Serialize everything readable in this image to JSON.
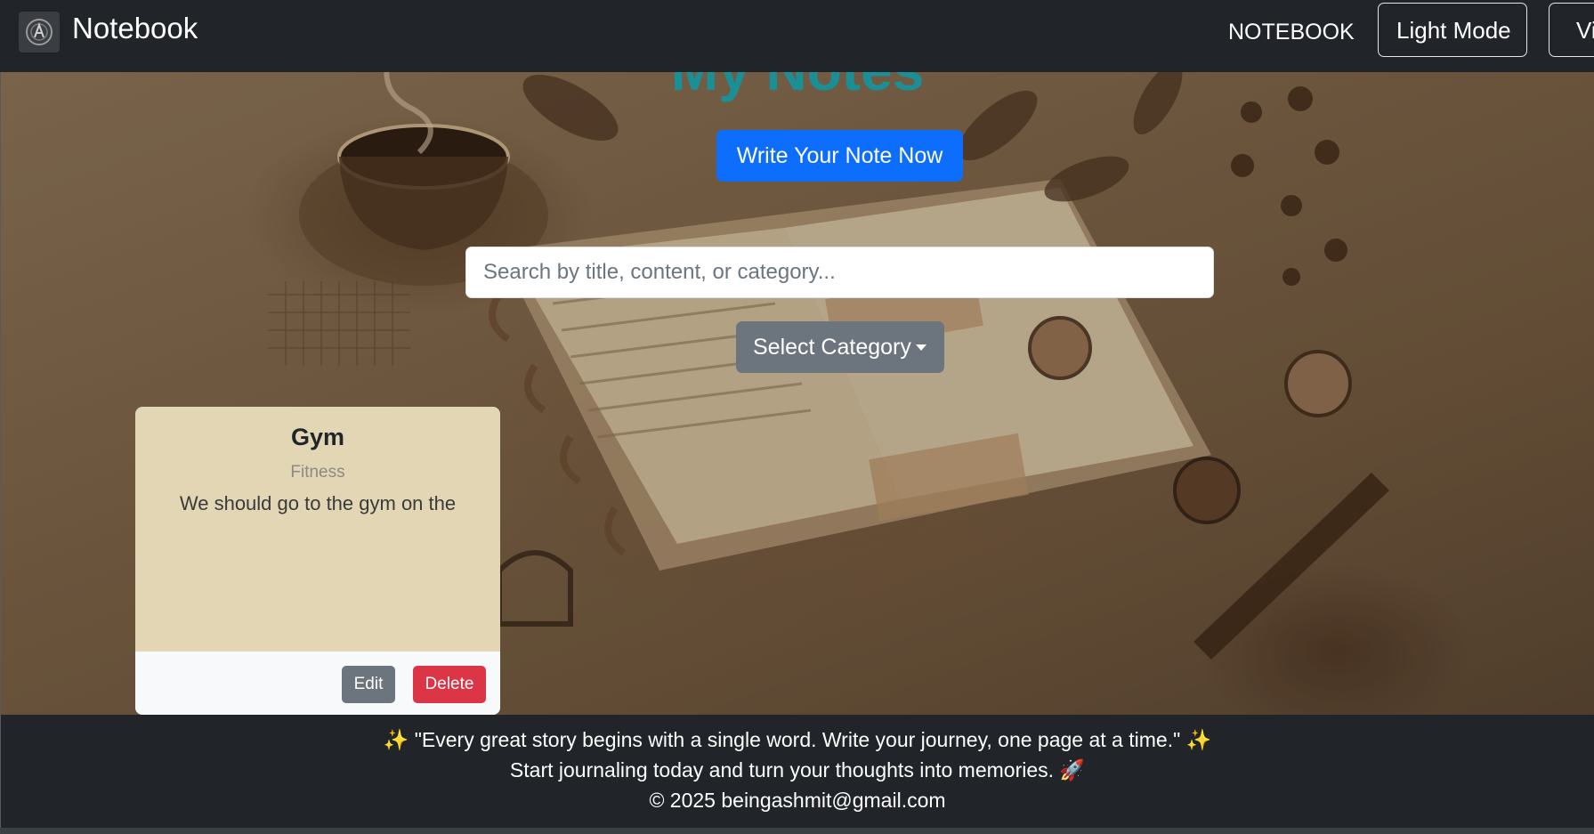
{
  "navbar": {
    "brand": "Notebook",
    "links": [
      "NOTEBOOK"
    ],
    "theme_button": "Light Mode",
    "extra_button": "Vi"
  },
  "hero": {
    "title": "My Notes",
    "write_button": "Write Your Note Now",
    "search_placeholder": "Search by title, content, or category...",
    "category_button": "Select Category"
  },
  "notes": [
    {
      "title": "Gym",
      "category": "Fitness",
      "content": "We should go to the gym on the",
      "edit_label": "Edit",
      "delete_label": "Delete"
    }
  ],
  "footer": {
    "quote": "✨  \"Every great story begins with a single word. Write your journey, one page at a time.\"  ✨",
    "tagline": "Start journaling today and turn your thoughts into memories. 🚀",
    "copyright": "© 2025 beingashmit@gmail.com"
  },
  "colors": {
    "navbar_bg": "#212529",
    "primary": "#0d6efd",
    "secondary": "#6c757d",
    "danger": "#dc3545",
    "note_bg": "#e2d6b5",
    "title_teal": "#1a8f95"
  }
}
